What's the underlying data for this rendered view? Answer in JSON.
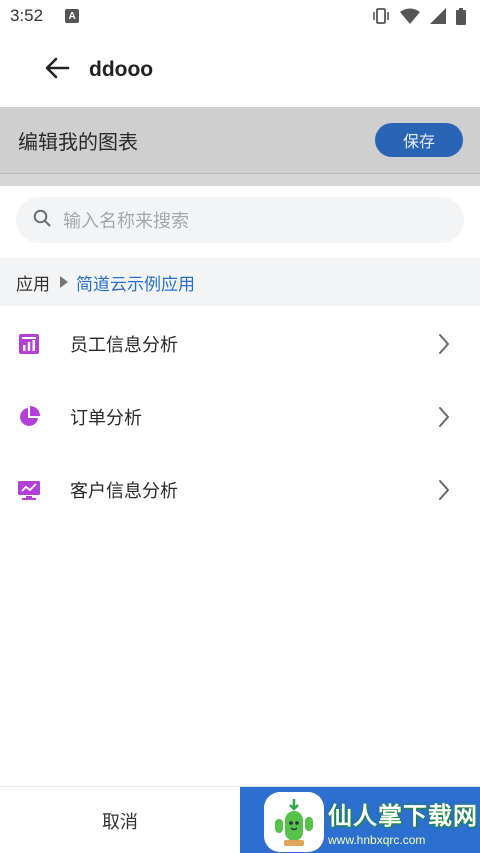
{
  "status_bar": {
    "time": "3:52",
    "notification_glyph": "A",
    "icons": [
      "vibrate-icon",
      "wifi-icon",
      "signal-icon",
      "battery-icon"
    ]
  },
  "app_bar": {
    "title": "ddooo",
    "back_icon": "arrow-left-icon"
  },
  "editor": {
    "title": "编辑我的图表",
    "save_label": "保存"
  },
  "search": {
    "placeholder": "输入名称来搜索"
  },
  "breadcrumb": {
    "root": "应用",
    "current": "简道云示例应用"
  },
  "list": {
    "items": [
      {
        "label": "员工信息分析",
        "icon": "bar-chart-icon",
        "color": "#b23fd6"
      },
      {
        "label": "订单分析",
        "icon": "pie-chart-icon",
        "color": "#b23fd6"
      },
      {
        "label": "客户信息分析",
        "icon": "monitor-chart-icon",
        "color": "#b23fd6"
      }
    ]
  },
  "bottom": {
    "cancel_label": "取消"
  },
  "watermark": {
    "title": "仙人掌下载网",
    "url": "www.hnbxqrc.com"
  },
  "colors": {
    "accent": "#2a64b5",
    "link": "#2a6fcc",
    "icon_purple": "#b23fd6"
  }
}
